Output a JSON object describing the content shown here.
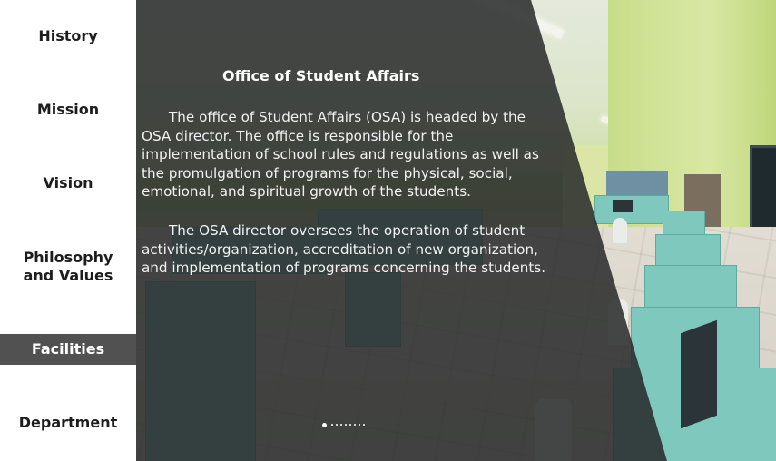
{
  "sidebar": {
    "items": [
      {
        "label": "History",
        "active": false
      },
      {
        "label": "Mission",
        "active": false
      },
      {
        "label": "Vision",
        "active": false
      },
      {
        "label": "Philosophy and Values",
        "active": false
      },
      {
        "label": "Facilities",
        "active": true
      },
      {
        "label": "Department",
        "active": false
      }
    ]
  },
  "slide": {
    "title": "Office of Student Affairs",
    "paragraphs": [
      "The office of Student Affairs (OSA) is headed by the OSA director. The office is responsible for the implementation of school rules and regulations as well as the promulgation of programs for the physical, social, emotional, and spiritual growth of the students.",
      "The OSA director oversees the operation of student activities/organization, accreditation of new organization, and implementation of programs concerning the students."
    ]
  },
  "pager": {
    "total": 9,
    "current": 1
  },
  "colors": {
    "sidebar_active_bg": "#515151",
    "overlay": "#2a2c2c",
    "carrel": "#7ec8bd"
  }
}
